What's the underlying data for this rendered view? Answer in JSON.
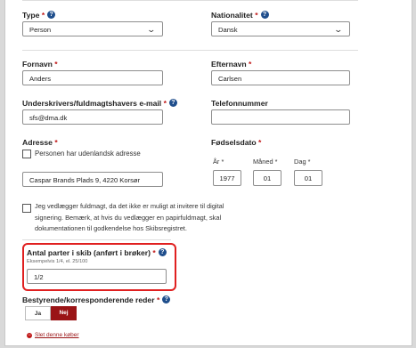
{
  "type_field": {
    "label": "Type",
    "value": "Person"
  },
  "nationality": {
    "label": "Nationalitet",
    "value": "Dansk"
  },
  "first_name": {
    "label": "Fornavn",
    "value": "Anders"
  },
  "last_name": {
    "label": "Efternavn",
    "value": "Carlsen"
  },
  "email": {
    "label": "Underskrivers/fuldmagtshavers e-mail",
    "value": "sfs@dma.dk"
  },
  "phone": {
    "label": "Telefonnummer",
    "value": ""
  },
  "address": {
    "label": "Adresse",
    "foreign_checkbox_label": "Personen har udenlandsk adresse",
    "value": "Caspar Brands Plads 9, 4220 Korsør"
  },
  "birthdate": {
    "label": "Fødselsdato",
    "year_label": "År",
    "year": "1977",
    "month_label": "Måned",
    "month": "01",
    "day_label": "Dag",
    "day": "01"
  },
  "power_of_attorney": {
    "line1": "Jeg vedlægger fuldmagt, da det ikke er muligt at invitere til digital",
    "line2": "signering. Bemærk, at hvis du vedlægger en papirfuldmagt, skal",
    "line3": "dokumentationen til godkendelse hos Skibsregistret."
  },
  "shares": {
    "label": "Antal parter i skib (anført i brøker)",
    "hint": "Eksempelvis 1/4, el. 25/100",
    "value": "1/2"
  },
  "managing_owner": {
    "label": "Bestyrende/korresponderende reder",
    "yes": "Ja",
    "no": "Nej"
  },
  "remove_link": "Slet denne køber",
  "help_glyph": "?",
  "required_marker": "*",
  "chevron_glyph": "⌄",
  "colors": {
    "accent": "#9a1416",
    "highlight": "#e02020",
    "help": "#1f4e8c"
  }
}
